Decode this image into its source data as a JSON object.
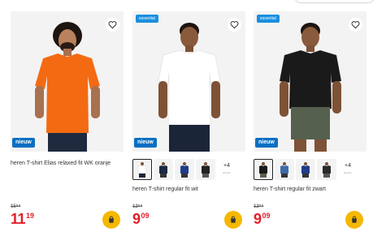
{
  "colors": {
    "price_red": "#e0202a",
    "cart_yellow": "#f5b800",
    "badge_nieuw": "#0a6fc2",
    "badge_essential": "#1a8fe0",
    "card_bg": "#f3f3f3"
  },
  "products": [
    {
      "title": "heren T-shirt Elias relaxed fit WK oranje",
      "badge_top": "",
      "badge_bottom": "nieuw",
      "old_price": "15⁹⁹",
      "price_euro": "11",
      "price_cents": "19",
      "shirt_color": "#f46a12",
      "icons": [
        "heart-icon",
        "shopping-bag-icon"
      ]
    },
    {
      "title": "heren T-shirt regular fit wit",
      "badge_top": "essential",
      "badge_bottom": "nieuw",
      "old_price": "12⁹⁹",
      "price_euro": "9",
      "price_cents": "09",
      "shirt_color": "#ffffff",
      "more_colors": "+4",
      "more_colors_note": "kleuren",
      "swatch_colors": [
        "#ffffff",
        "#1c2a44",
        "#1f3c8a",
        "#222222"
      ],
      "icons": [
        "heart-icon",
        "shopping-bag-icon"
      ]
    },
    {
      "title": "heren T-shirt regular fit zwart",
      "badge_top": "essential",
      "badge_bottom": "nieuw",
      "old_price": "12⁹⁹",
      "price_euro": "9",
      "price_cents": "09",
      "shirt_color": "#1a1a1a",
      "more_colors": "+4",
      "more_colors_note": "kleuren",
      "swatch_colors": [
        "#1a1a1a",
        "#3f6aa8",
        "#1f3c8a",
        "#2a2a2a"
      ],
      "icons": [
        "heart-icon",
        "shopping-bag-icon"
      ]
    }
  ]
}
